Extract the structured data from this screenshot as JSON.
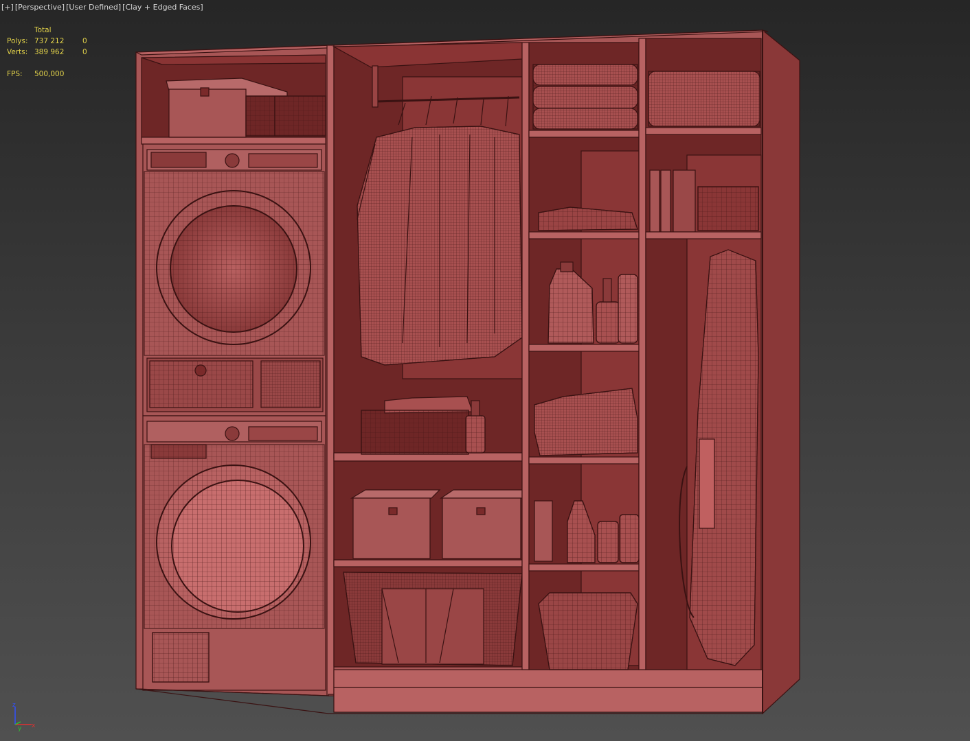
{
  "viewport": {
    "labels": [
      "[+]",
      "[Perspective]",
      "[User Defined]",
      "[Clay + Edged Faces]"
    ]
  },
  "stats": {
    "header": "Total",
    "polys_label": "Polys:",
    "polys_total": "737 212",
    "polys_sel": "0",
    "verts_label": "Verts:",
    "verts_total": "389 962",
    "verts_sel": "0",
    "fps_label": "FPS:",
    "fps_value": "500,000"
  },
  "axis_gizmo": {
    "x": "x",
    "y": "y",
    "z": "z"
  },
  "colors": {
    "clay": "#a85656",
    "clay_dark": "#6a2424",
    "clay_light": "#c06a6a",
    "wire": "#3a1212",
    "stats_text": "#e2d24a"
  },
  "icons": [
    "axis-gizmo-icon"
  ]
}
